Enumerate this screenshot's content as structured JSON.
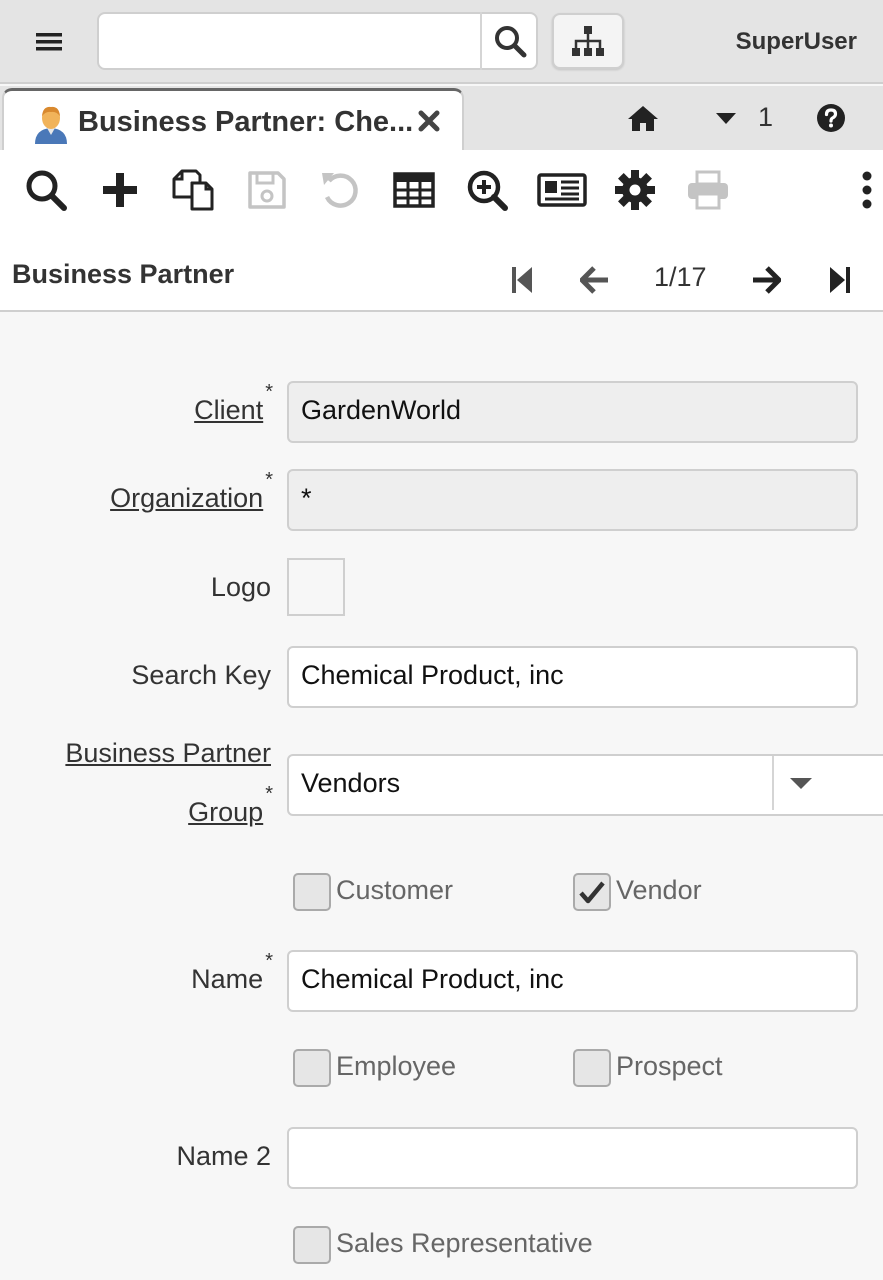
{
  "header": {
    "user": "SuperUser",
    "search": {
      "value": "",
      "placeholder": ""
    }
  },
  "tab": {
    "title": "Business Partner: Che...",
    "count": "1"
  },
  "toolbar": {
    "icons": [
      "search-icon",
      "new-record-icon",
      "copy-icon",
      "save-icon",
      "undo-icon",
      "grid-icon",
      "zoom-icon",
      "report-icon",
      "settings-icon",
      "print-icon",
      "more-vertical-icon"
    ],
    "disabled": [
      "save-icon",
      "undo-icon",
      "print-icon"
    ]
  },
  "record": {
    "title": "Business Partner",
    "position": "1/17"
  },
  "form": {
    "client": {
      "label": "Client",
      "value": "GardenWorld",
      "required": "*"
    },
    "organization": {
      "label": "Organization",
      "value": "*",
      "required": "*"
    },
    "logo": {
      "label": "Logo"
    },
    "search_key": {
      "label": "Search Key",
      "value": "Chemical Product, inc"
    },
    "bp_group": {
      "label_line1": "Business Partner",
      "label_line2": "Group",
      "value": "Vendors",
      "required": "*"
    },
    "customer": {
      "label": "Customer",
      "checked": false
    },
    "vendor": {
      "label": "Vendor",
      "checked": true
    },
    "name": {
      "label": "Name",
      "value": "Chemical Product, inc",
      "required": "*"
    },
    "employee": {
      "label": "Employee",
      "checked": false
    },
    "prospect": {
      "label": "Prospect",
      "checked": false
    },
    "name2": {
      "label": "Name 2",
      "value": ""
    },
    "sales_rep": {
      "label": "Sales Representative",
      "checked": false
    }
  },
  "colors": {
    "topbar": "#e4e4e4",
    "accent": "#333333",
    "disabled_icon": "#c4c4c4",
    "readonly_field": "#eeeeee"
  }
}
